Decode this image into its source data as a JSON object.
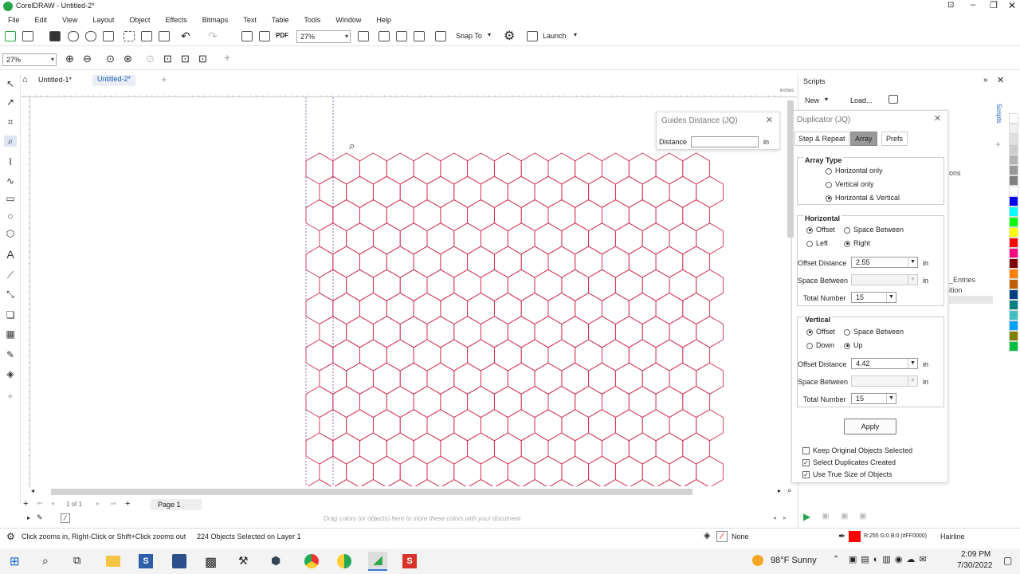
{
  "window": {
    "title": "CorelDRAW - Untitled-2*"
  },
  "menu": [
    "File",
    "Edit",
    "View",
    "Layout",
    "Object",
    "Effects",
    "Bitmaps",
    "Text",
    "Table",
    "Tools",
    "Window",
    "Help"
  ],
  "toolbar": {
    "zoom_value": "27%",
    "snap_label": "Snap To",
    "launch_label": "Launch",
    "pdf_label": "PDF"
  },
  "propbar": {
    "zoom_value": "27%"
  },
  "tabs": {
    "tab1": "Untitled-1*",
    "tab2": "Untitled-2*"
  },
  "ruler": {
    "units": "inches"
  },
  "guides_dialog": {
    "title": "Guides Distance (JQ)",
    "distance_label": "Distance",
    "distance_value": "",
    "unit": "in"
  },
  "scripts_panel": {
    "title": "Scripts",
    "new_label": "New",
    "load_label": "Load...",
    "side_tab": "Scripts",
    "partial_items": [
      "ons",
      "_Entries",
      "ition"
    ]
  },
  "duplicator": {
    "title": "Duplicator (JQ)",
    "tabs": [
      "Step & Repeat",
      "Array",
      "Prefs"
    ],
    "array_type": {
      "title": "Array Type",
      "options": [
        "Horizontal only",
        "Vertical only",
        "Horizontal & Vertical"
      ],
      "selected": 2
    },
    "horizontal": {
      "title": "Horizontal",
      "offset_label": "Offset",
      "space_between_label": "Space Between",
      "left_label": "Left",
      "right_label": "Right",
      "offset_distance_label": "Offset Distance",
      "offset_distance_value": "2.55",
      "space_between_field_label": "Space Between",
      "space_between_value": "",
      "total_number_label": "Total Number",
      "total_number_value": "15",
      "unit": "in"
    },
    "vertical": {
      "title": "Vertical",
      "offset_label": "Offset",
      "space_between_label": "Space Between",
      "down_label": "Down",
      "up_label": "Up",
      "offset_distance_label": "Offset Distance",
      "offset_distance_value": "4.42",
      "space_between_field_label": "Space Between",
      "space_between_value": "",
      "total_number_label": "Total Number",
      "total_number_value": "15",
      "unit": "in"
    },
    "apply_label": "Apply",
    "checks": [
      {
        "label": "Keep Original Objects Selected",
        "checked": false
      },
      {
        "label": "Select Duplicates Created",
        "checked": true
      },
      {
        "label": "Use True Size of Objects",
        "checked": true
      }
    ]
  },
  "pagebar": {
    "page_info": "1  of  1",
    "page_tab": "Page 1"
  },
  "colorbar": {
    "hint": "Drag colors (or objects) here to store these colors with your document"
  },
  "status": {
    "hint": "Click zooms in, Right-Click or Shift+Click zooms out",
    "selection": "224 Objects Selected on Layer 1",
    "fill_label": "None",
    "outline_color": "R:255 G:0 B:0 (#FF0000)",
    "outline_width": "Hairline"
  },
  "taskbar": {
    "weather": "98°F  Sunny",
    "time": "2:09 PM",
    "date": "7/30/2022"
  },
  "colors": {
    "accent": "#3b7bd8",
    "hex_outline": "#d03050",
    "guide": "#7a3fbf",
    "palette": [
      "#ffffff",
      "#f0f0f0",
      "#e0e0e0",
      "#cccccc",
      "#b3b3b3",
      "#999999",
      "#808080",
      "#ffffff",
      "#0000ff",
      "#00ffff",
      "#00ff00",
      "#ffff00",
      "#ff0000",
      "#ff0080",
      "#800000",
      "#ff8000",
      "#c06000",
      "#004080",
      "#008080",
      "#40c0c0",
      "#00a0ff",
      "#808000",
      "#00c040"
    ]
  }
}
